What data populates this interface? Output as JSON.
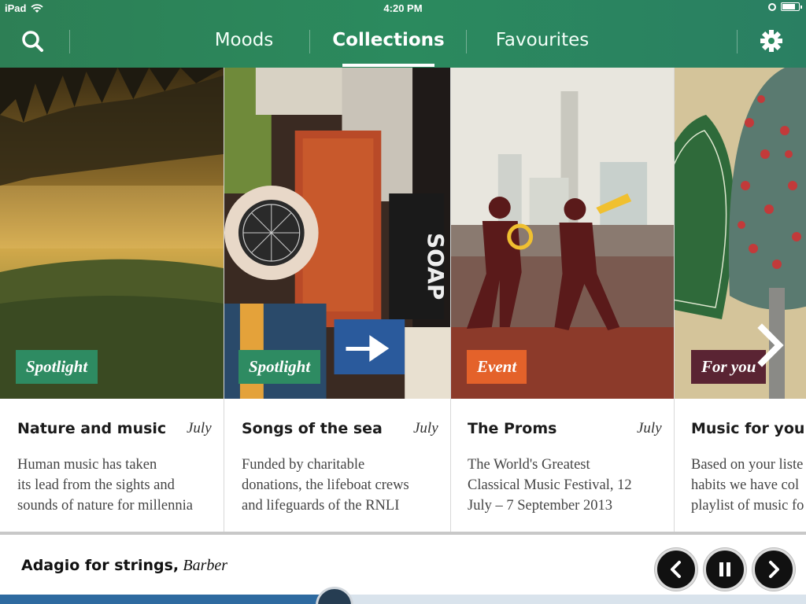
{
  "status_bar": {
    "device": "iPad",
    "time": "4:20 PM",
    "battery_level": 0.85
  },
  "nav": {
    "tabs": [
      {
        "label": "Moods",
        "active": false
      },
      {
        "label": "Collections",
        "active": true
      },
      {
        "label": "Favourites",
        "active": false
      }
    ],
    "icons": [
      "search-icon",
      "gear-icon"
    ]
  },
  "cards": [
    {
      "badge": "Spotlight",
      "badge_color": "#2e8b62",
      "title": "Nature and music",
      "date": "July",
      "description": "Human music has taken\nits lead from the sights and\nsounds of nature for millennia"
    },
    {
      "badge": "Spotlight",
      "badge_color": "#2e8b62",
      "title": "Songs of the sea",
      "date": "July",
      "description": "Funded by charitable\ndonations, the lifeboat crews\nand lifeguards of the RNLI"
    },
    {
      "badge": "Event",
      "badge_color": "#e4622a",
      "title": "The Proms",
      "date": "July",
      "description": "The World's Greatest\nClassical Music Festival, 12\nJuly – 7 September 2013"
    },
    {
      "badge": "For you",
      "badge_color": "#5a2433",
      "title": "Music for you",
      "date": "",
      "description": "Based on your liste\nhabits we have col\nplaylist of music fo"
    }
  ],
  "carousel": {
    "next_icon": "chevron-right-icon"
  },
  "player": {
    "track_title": "Adagio for strings,",
    "track_artist": "Barber",
    "controls": [
      "chevron-left-icon",
      "pause-icon",
      "chevron-right-icon"
    ],
    "progress": 0.415,
    "colors": {
      "fill": "#2e6aa0",
      "track": "#d9e3ec"
    }
  }
}
